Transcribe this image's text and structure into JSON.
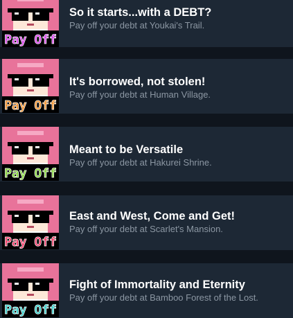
{
  "achievements": [
    {
      "title": "So it starts...with a DEBT?",
      "description": "Pay off your debt at Youkai's Trail.",
      "badge_text": "Pay Off",
      "badge_color": "#d633e8"
    },
    {
      "title": "It's borrowed, not stolen!",
      "description": "Pay off your debt at Human Village.",
      "badge_text": "Pay Off",
      "badge_color": "#f08a1e"
    },
    {
      "title": "Meant to be Versatile",
      "description": "Pay off your debt at Hakurei Shrine.",
      "badge_text": "Pay Off",
      "badge_color": "#7dd12c"
    },
    {
      "title": "East and West, Come and Get!",
      "description": "Pay off your debt at Scarlet's Mansion.",
      "badge_text": "Pay Off",
      "badge_color": "#f02e5c"
    },
    {
      "title": "Fight of Immortality and Eternity",
      "description": "Pay off your debt at Bamboo Forest of the Lost.",
      "badge_text": "Pay Off",
      "badge_color": "#27c9c4"
    }
  ],
  "colors": {
    "background": "#0f151d",
    "row": "#1d2835",
    "title": "#ffffff",
    "description": "#8c97a3",
    "hair": "#e8739a",
    "glasses": "#000000"
  }
}
